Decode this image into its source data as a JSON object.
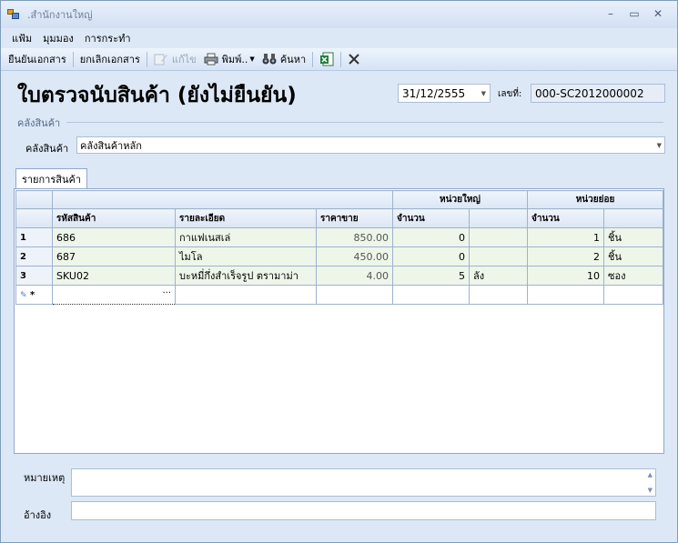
{
  "window": {
    "title": ".สำนักงานใหญ่",
    "controls": [
      "minimize-icon",
      "maximize-icon",
      "close-icon"
    ]
  },
  "menu": {
    "items": [
      "แฟ้ม",
      "มุมมอง",
      "การกระทำ"
    ]
  },
  "toolbar": {
    "confirm_label": "ยืนยันเอกสาร",
    "cancel_label": "ยกเลิกเอกสาร",
    "edit_label": "แก้ไข",
    "print_label": "พิมพ์..",
    "search_label": "ค้นหา"
  },
  "header": {
    "title": "ใบตรวจนับสินค้า (ยังไม่ยืนยัน)",
    "date": "31/12/2555",
    "doc_no_label": "เลขที่:",
    "doc_no": "000-SC2012000002"
  },
  "warehouse": {
    "group_label": "คลังสินค้า",
    "field_label": "คลังสินค้า",
    "value": "คลังสินค้าหลัก"
  },
  "tabs": [
    {
      "label": "รายการสินค้า"
    }
  ],
  "grid": {
    "group_headers": {
      "big_unit": "หน่วยใหญ่",
      "small_unit": "หน่วยย่อย"
    },
    "columns": {
      "code": "รหัสสินค้า",
      "detail": "รายละเอียด",
      "price": "ราคาขาย",
      "big_qty": "จำนวน",
      "small_qty": "จำนวน"
    },
    "rows": [
      {
        "no": "1",
        "code": "686",
        "detail": "กาแฟเนสเล่",
        "price": "850.00",
        "big_qty": "0",
        "big_unit": "",
        "small_qty": "1",
        "small_unit": "ชิ้น"
      },
      {
        "no": "2",
        "code": "687",
        "detail": "ไมโล",
        "price": "450.00",
        "big_qty": "0",
        "big_unit": "",
        "small_qty": "2",
        "small_unit": "ชิ้น"
      },
      {
        "no": "3",
        "code": "SKU02",
        "detail": "บะหมี่กึ่งสำเร็จรูป ตรามาม่า",
        "price": "4.00",
        "big_qty": "5",
        "big_unit": "ลัง",
        "small_qty": "10",
        "small_unit": "ซอง"
      }
    ],
    "new_row_marker": "*",
    "lookup_button": "···"
  },
  "footer": {
    "note_label": "หมายเหตุ",
    "note_value": "",
    "ref_label": "อ้างอิง",
    "ref_value": ""
  }
}
